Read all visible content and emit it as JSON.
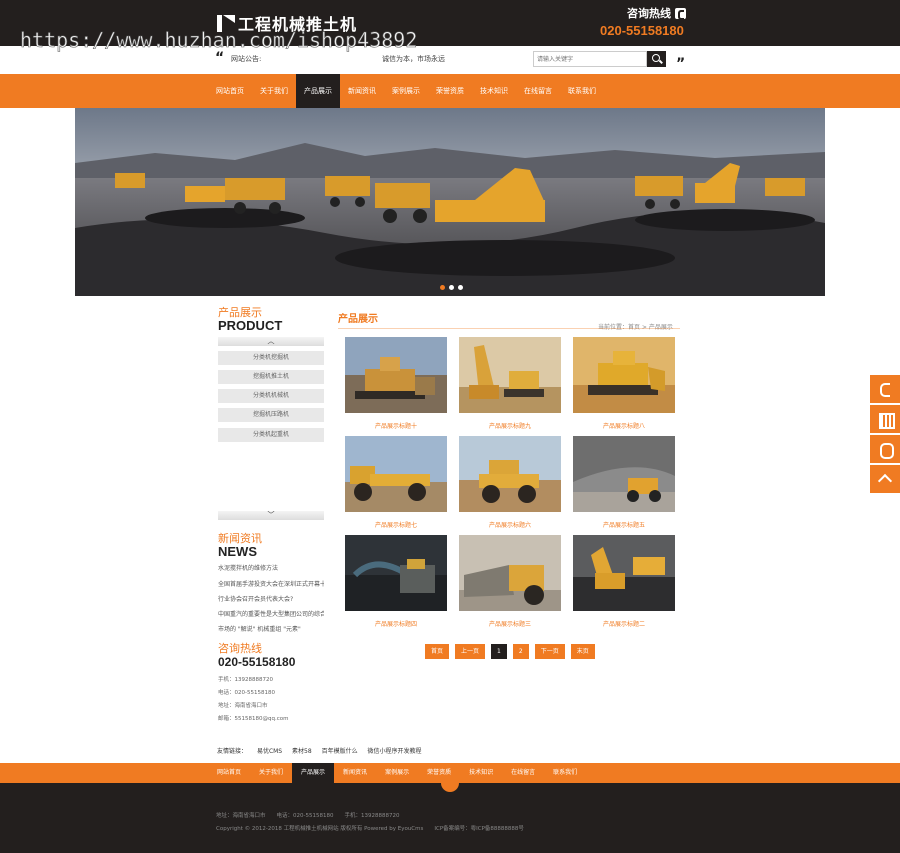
{
  "header": {
    "logo_text": "工程机械推土机",
    "hotline_label": "咨询热线",
    "hotline_number": "020-55158180",
    "watermark": "https://www.huzhan.com/ishop43892"
  },
  "notice": {
    "label": "网站公告:",
    "text": "诚信为本，市场永远",
    "search_placeholder": "请输入关键字"
  },
  "nav": {
    "items": [
      "网站首页",
      "关于我们",
      "产品展示",
      "新闻资讯",
      "案例展示",
      "荣誉资质",
      "技术知识",
      "在线留言",
      "联系我们"
    ],
    "active_index": 2
  },
  "banner": {
    "slide_count": 3,
    "active_slide": 0
  },
  "sidebar": {
    "product_title": "产品展示",
    "product_en": "PRODUCT",
    "categories": [
      "分类机挖掘机",
      "挖掘机推土机",
      "分类机机械机",
      "挖掘机压路机",
      "分类机起重机"
    ],
    "news_title": "新闻资讯",
    "news_en": "NEWS",
    "news": [
      "水泥搅拌机的维修方法",
      "全国首届手游投资大会在深圳正式开幕十强...",
      "行业协会召开会员代表大会?",
      "中国重汽的重要性是大型集团公司的综合...",
      "市场的 \"解说\" 机械重组 \"元素\""
    ],
    "contact_title": "咨询热线",
    "contact_number": "020-55158180",
    "contact_lines": [
      "手机：13928888720",
      "电话：020-55158180",
      "地址：海南省海口市",
      "邮箱：55158180@qq.com"
    ]
  },
  "main": {
    "title": "产品展示",
    "breadcrumb": "当前位置：首页 > 产品展示",
    "products": [
      "产品展示标题十",
      "产品展示标题九",
      "产品展示标题八",
      "产品展示标题七",
      "产品展示标题六",
      "产品展示标题五",
      "产品展示标题四",
      "产品展示标题三",
      "产品展示标题二"
    ],
    "pager": {
      "first": "首页",
      "prev": "上一页",
      "pages": [
        "1",
        "2"
      ],
      "current": "1",
      "next": "下一页",
      "last": "末页"
    }
  },
  "links": {
    "label": "友情链接：",
    "items": [
      "易优CMS",
      "素材58",
      "百年模版什么",
      "微信小程序开发教程"
    ]
  },
  "footer": {
    "nav": [
      "网站首页",
      "关于我们",
      "产品展示",
      "新闻资讯",
      "案例展示",
      "荣誉资质",
      "技术知识",
      "在线留言",
      "联系我们"
    ],
    "address_line": "地址：海南省海口市　　电话：020-55158180　　手机：13928888720",
    "copyright": "Copyright © 2012-2018 工程机械推土机械网站 版权所有 Powered by EyouCms　　ICP备案编号：粤ICP备88888888号"
  },
  "colors": {
    "accent": "#f07b22",
    "dark": "#231f1e"
  }
}
